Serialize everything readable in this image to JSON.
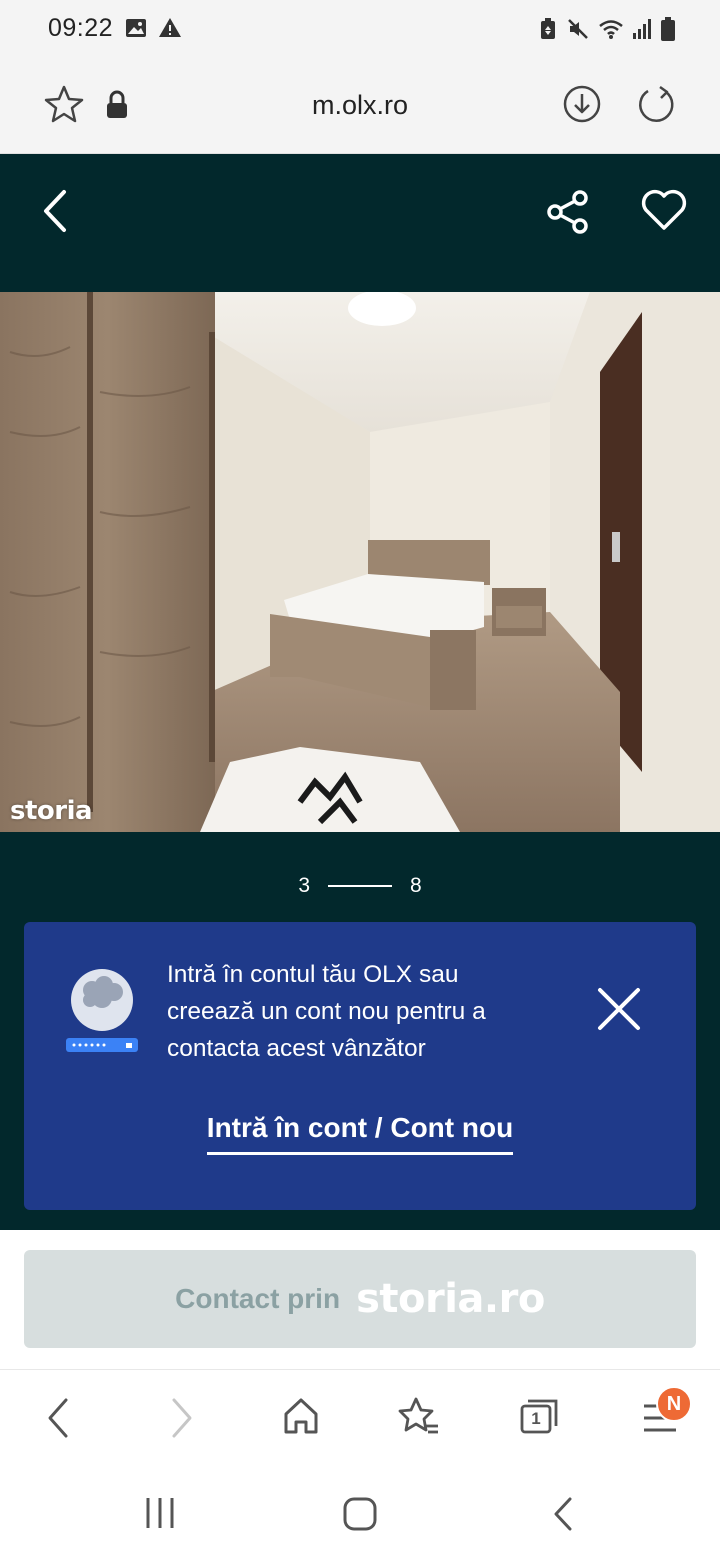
{
  "status_bar": {
    "time": "09:22",
    "icons_left": [
      "image-icon",
      "warning-icon"
    ],
    "icons_right": [
      "battery-saver-icon",
      "mute-icon",
      "wifi-icon",
      "signal-icon",
      "battery-icon"
    ]
  },
  "browser": {
    "url": "m.olx.ro",
    "icons": [
      "star-icon",
      "lock-icon",
      "download-icon",
      "refresh-icon"
    ]
  },
  "header": {
    "icons": [
      "back-icon",
      "share-icon",
      "heart-icon"
    ]
  },
  "gallery": {
    "watermark": "storia",
    "current": "3",
    "total": "8"
  },
  "login_prompt": {
    "message": "Intră în contul tău OLX sau creează un cont nou pentru a contacta acest vânzător",
    "link": "Intră în cont / Cont nou",
    "colors": {
      "card": "#1f3a8a",
      "background": "#02282c"
    }
  },
  "contact": {
    "label": "Contact prin",
    "brand": "storia.ro"
  },
  "browser_nav": {
    "badge": "N",
    "tab_count": "1",
    "badge_color": "#ee6a35"
  }
}
